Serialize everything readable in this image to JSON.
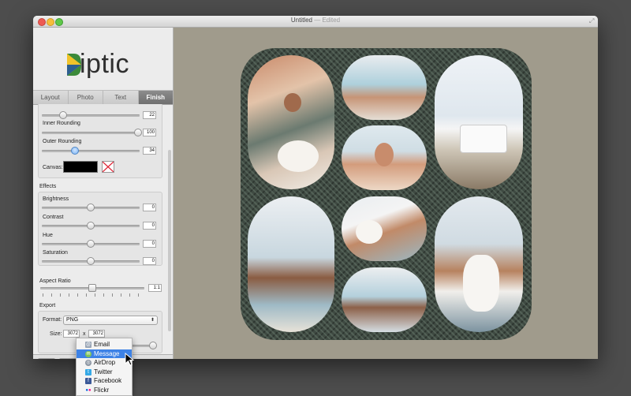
{
  "window": {
    "title": "Untitled",
    "status": "— Edited"
  },
  "app": {
    "logo_text": "iptic"
  },
  "tabs": [
    {
      "label": "Layout"
    },
    {
      "label": "Photo"
    },
    {
      "label": "Text"
    },
    {
      "label": "Finish"
    }
  ],
  "layout_controls": {
    "top_value": "22",
    "top_level": 0.2,
    "inner_rounding_label": "Inner Rounding",
    "inner_rounding_value": "100",
    "inner_rounding_level": 1.0,
    "outer_rounding_label": "Outer Rounding",
    "outer_rounding_value": "34",
    "outer_rounding_level": 0.34,
    "canvas_label": "Canvas:",
    "canvas_color": "#000000"
  },
  "effects": {
    "header": "Effects",
    "brightness_label": "Brightness",
    "brightness_value": "0",
    "contrast_label": "Contrast",
    "contrast_value": "0",
    "hue_label": "Hue",
    "hue_value": "0",
    "saturation_label": "Saturation",
    "saturation_value": "0"
  },
  "aspect_ratio": {
    "header": "Aspect Ratio",
    "value": "1:1"
  },
  "export": {
    "header": "Export",
    "format_label": "Format:",
    "format_value": "PNG",
    "size_label": "Size:",
    "width": "3072",
    "times": "x",
    "height": "3072"
  },
  "share_menu": {
    "items": [
      {
        "label": "Email",
        "icon": "email-icon"
      },
      {
        "label": "Message",
        "icon": "message-icon"
      },
      {
        "label": "AirDrop",
        "icon": "airdrop-icon"
      },
      {
        "label": "Twitter",
        "icon": "twitter-icon"
      },
      {
        "label": "Facebook",
        "icon": "facebook-icon"
      },
      {
        "label": "Flickr",
        "icon": "flickr-icon"
      }
    ],
    "selected_index": 1
  },
  "colors": {
    "accent": "#3d82e6",
    "canvas_bg": "#a09b8c",
    "board": "#3f4a42"
  }
}
